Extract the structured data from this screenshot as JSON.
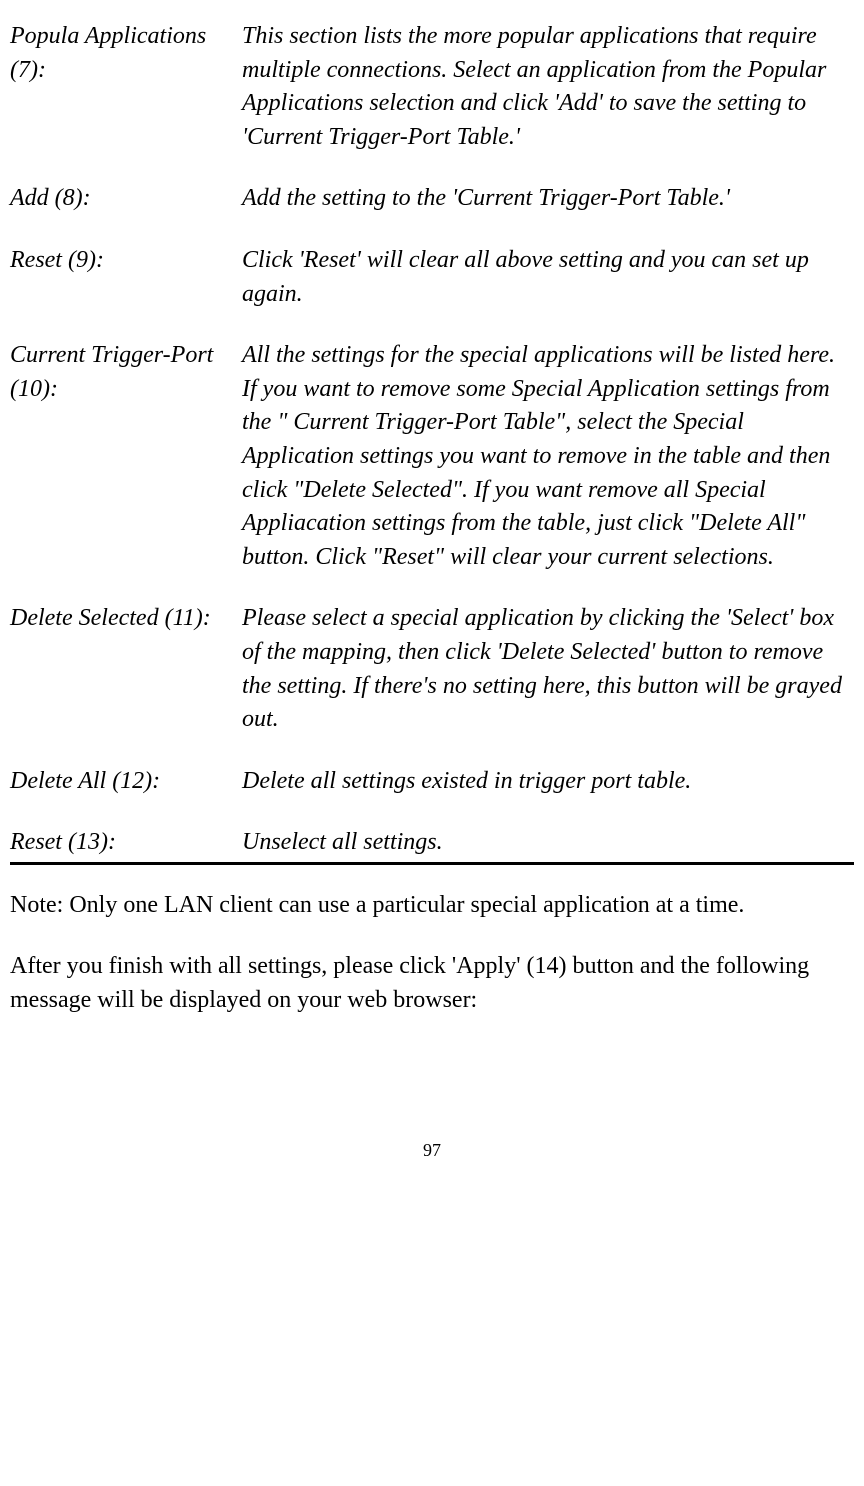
{
  "definitions": [
    {
      "term": "Popula Applications (7):",
      "desc": "This section lists the more popular applications that require multiple connections. Select an application from the Popular Applications selection and click 'Add' to save the setting to 'Current Trigger-Port Table.'"
    },
    {
      "term": "Add (8):",
      "desc": "Add the setting to the 'Current Trigger-Port Table.'"
    },
    {
      "term": "Reset (9):",
      "desc": "Click 'Reset' will clear all above setting and you can set up again."
    },
    {
      "term": "Current Trigger-Port (10):",
      "desc": "All the settings for the special applications will be listed here. If you want to remove some Special Application settings from the \" Current Trigger-Port Table\", select the Special Application settings you want to remove in the table and then click \"Delete Selected\". If you want remove all Special Appliacation settings from the table, just click \"Delete All\" button. Click \"Reset\" will clear your current selections."
    },
    {
      "term": "Delete Selected (11):",
      "desc": "Please select a special application by clicking the 'Select' box of the mapping, then click 'Delete Selected' button to remove the setting. If there's no setting here, this button will be grayed out."
    },
    {
      "term": "Delete All (12):",
      "desc": "Delete all settings existed in trigger port table."
    },
    {
      "term": "Reset (13):",
      "desc": "Unselect all settings."
    }
  ],
  "note": "Note: Only one LAN client can use a particular special application at a time.",
  "after": "After you finish with all settings, please click 'Apply' (14) button and the following message will be displayed on your web browser:",
  "pageNumber": "97"
}
